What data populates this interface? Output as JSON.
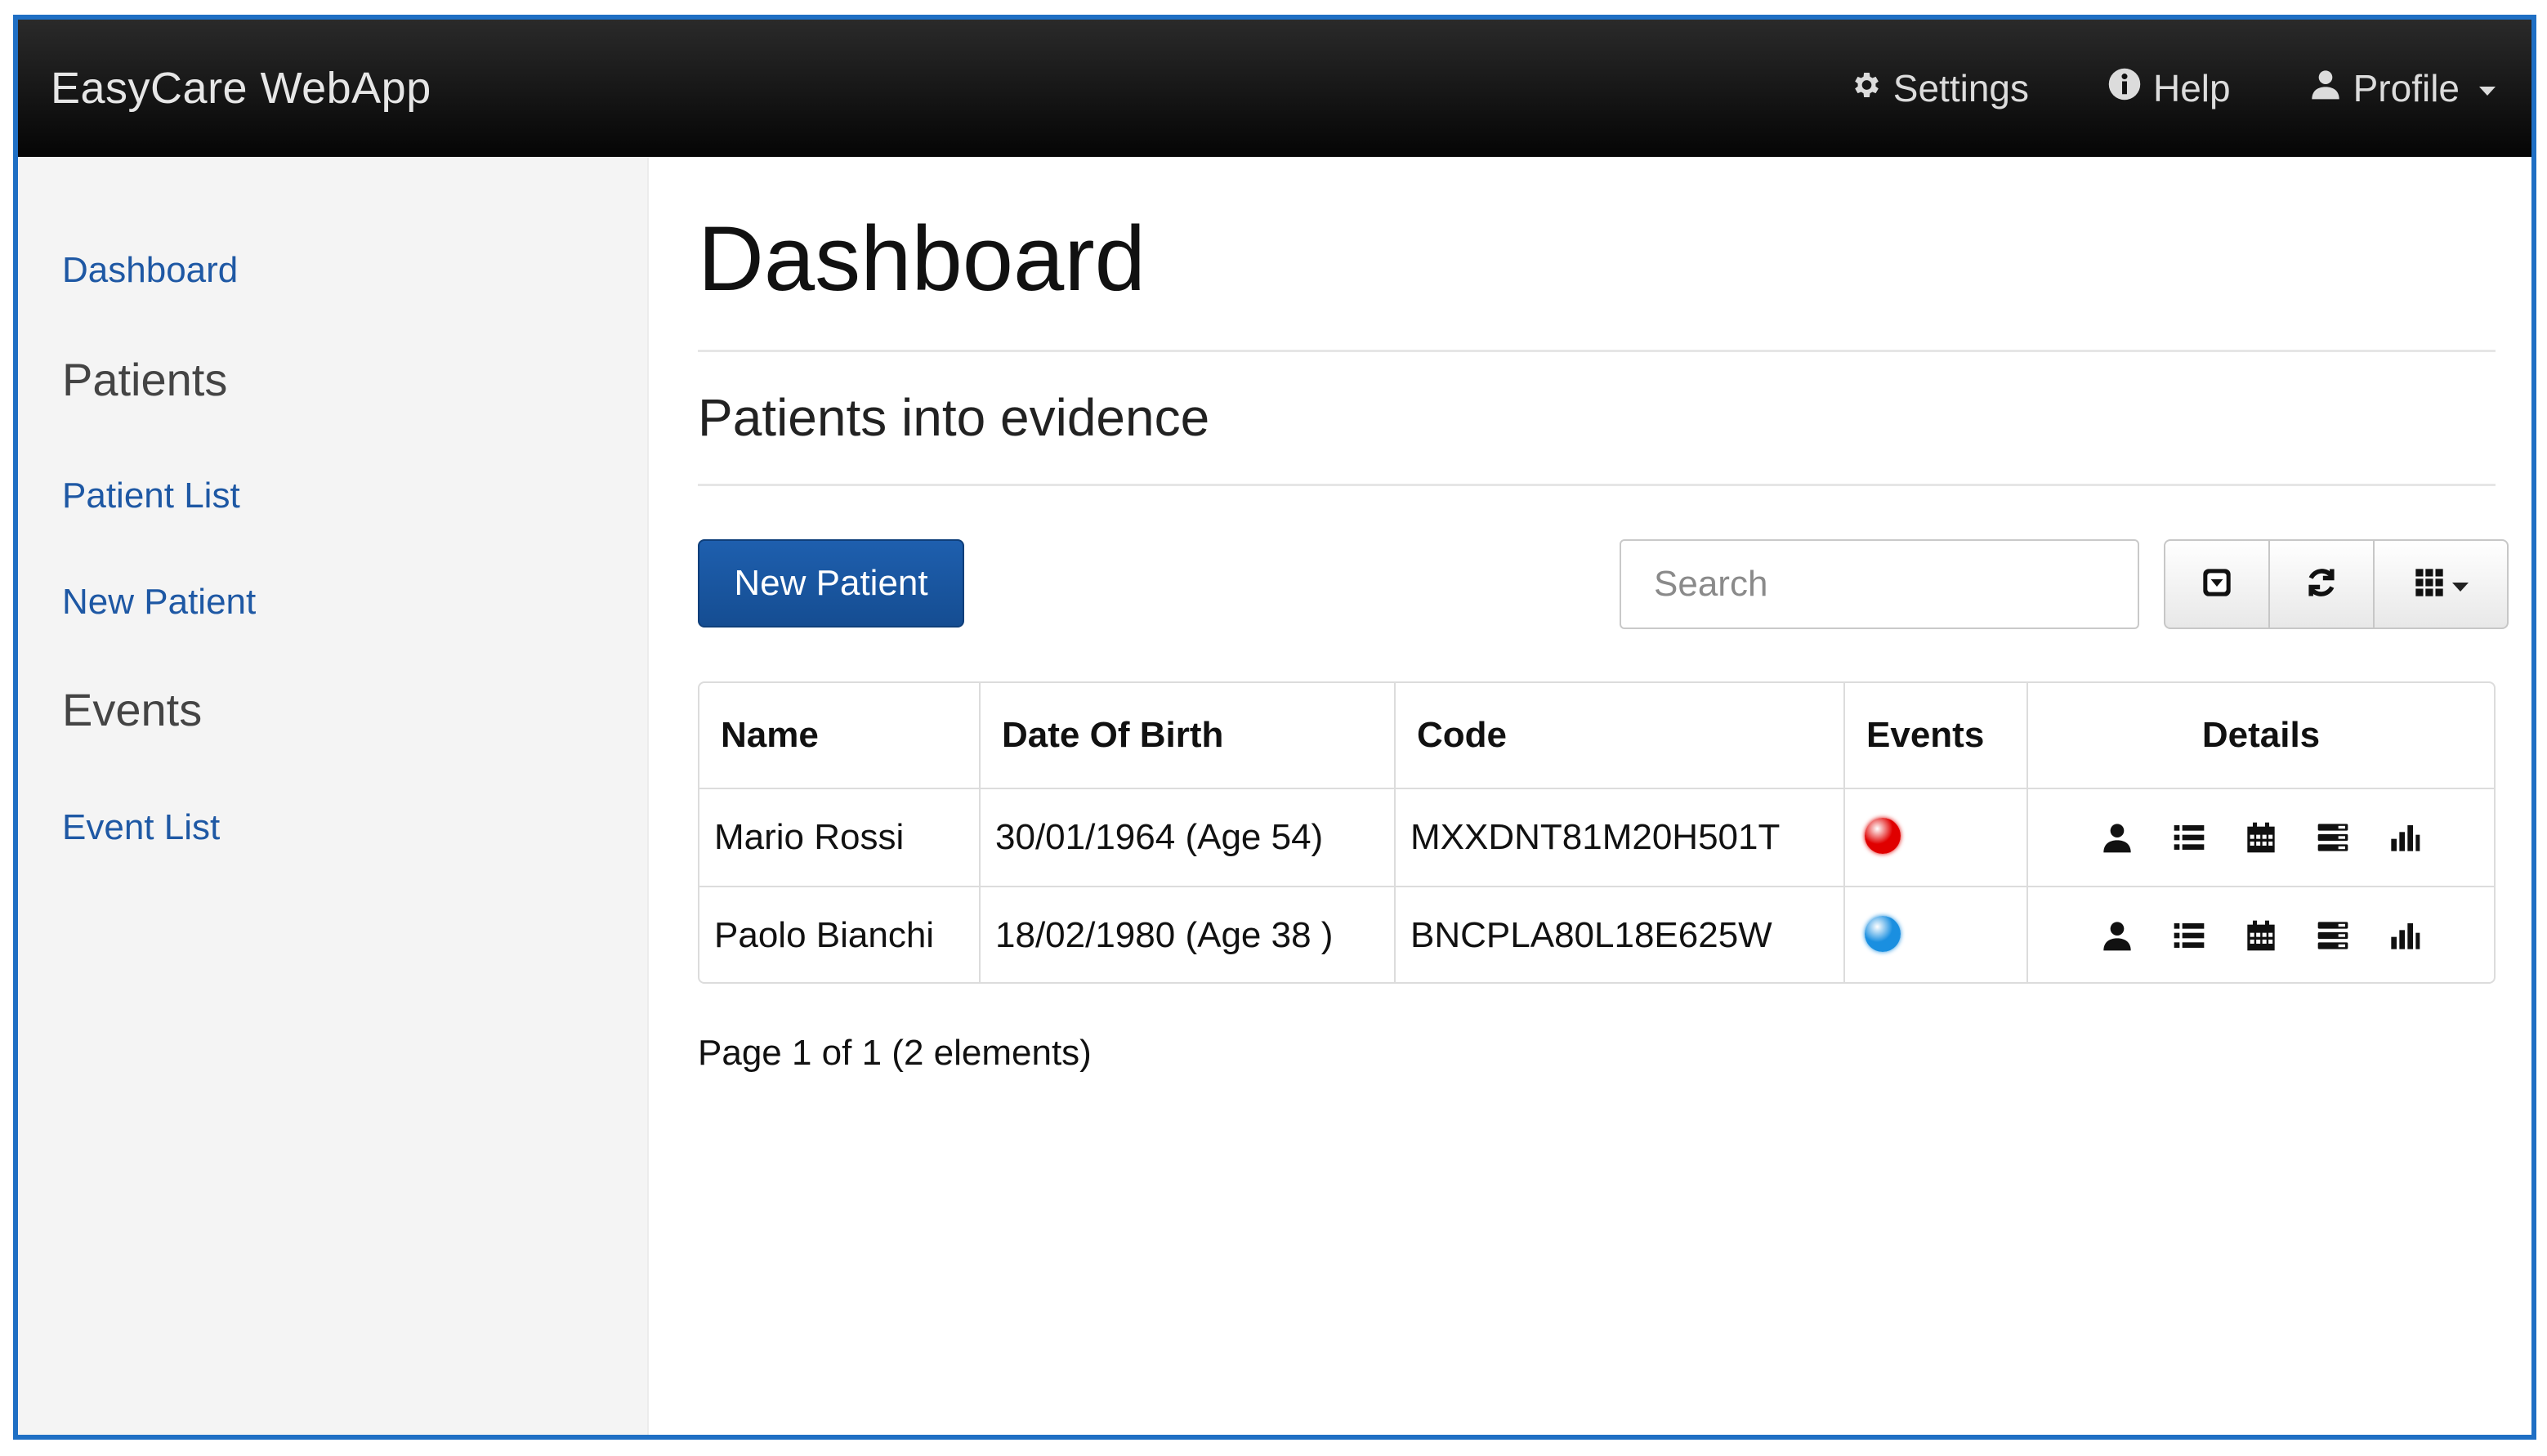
{
  "navbar": {
    "brand": "EasyCare WebApp",
    "settings_label": "Settings",
    "help_label": "Help",
    "profile_label": "Profile"
  },
  "sidebar": {
    "dashboard": "Dashboard",
    "patients_heading": "Patients",
    "patient_list": "Patient List",
    "new_patient": "New Patient",
    "events_heading": "Events",
    "event_list": "Event List"
  },
  "main": {
    "title": "Dashboard",
    "section_title": "Patients into evidence",
    "new_patient_button": "New Patient",
    "search_placeholder": "Search"
  },
  "table": {
    "headers": [
      "Name",
      "Date Of Birth",
      "Code",
      "Events",
      "Details"
    ],
    "rows": [
      {
        "name": "Mario Rossi",
        "dob": "30/01/1964 (Age 54)",
        "code": "MXXDNT81M20H501T",
        "event_color": "#e00000"
      },
      {
        "name": "Paolo Bianchi",
        "dob": "18/02/1980 (Age 38 )",
        "code": "BNCPLA80L18E625W",
        "event_color": "#1a8fe0"
      }
    ],
    "detail_icons": [
      "user-icon",
      "list-icon",
      "calendar-icon",
      "tasks-icon",
      "bar-chart-icon"
    ]
  },
  "pager": {
    "text": "Page 1 of 1 (2 elements)"
  },
  "colors": {
    "brand_blue": "#1e5fae",
    "link_blue": "#1e58a4",
    "frame_blue": "#1f6fc4"
  }
}
